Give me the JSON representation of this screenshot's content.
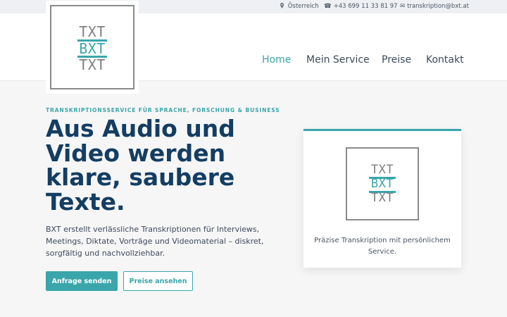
{
  "topbar": {
    "location_icon": "map-pin-icon",
    "location": "Österreich",
    "phone_glyph": "☎",
    "phone": "+43 699 11 33 81 97",
    "email_glyph": "✉",
    "email": "transkription@bxt.at"
  },
  "logo": {
    "line1": "TXT",
    "line2": "BXT",
    "line3": "TXT"
  },
  "nav": {
    "items": [
      {
        "label": "Home"
      },
      {
        "label": "Mein Service"
      },
      {
        "label": "Preise"
      },
      {
        "label": "Kontakt"
      }
    ]
  },
  "hero": {
    "kicker": "TRANSKRIPTIONSSERVICE FÜR SPRACHE, FORSCHUNG & BUSINESS",
    "title": "Aus Audio und Video werden klare, saubere Texte.",
    "text": "BXT erstellt verlässliche Transkriptionen für Interviews, Meetings, Diktate, Vorträge und Videomaterial – diskret, sorgfältig und nachvollziehbar.",
    "primary_button": "Anfrage senden",
    "secondary_button": "Preise ansehen"
  },
  "card": {
    "caption": "Präzise Transkription mit persönlichem Service."
  },
  "colors": {
    "accent": "#3aa6ab",
    "heading": "#143d62",
    "logo_gray": "#8a8a8a"
  }
}
